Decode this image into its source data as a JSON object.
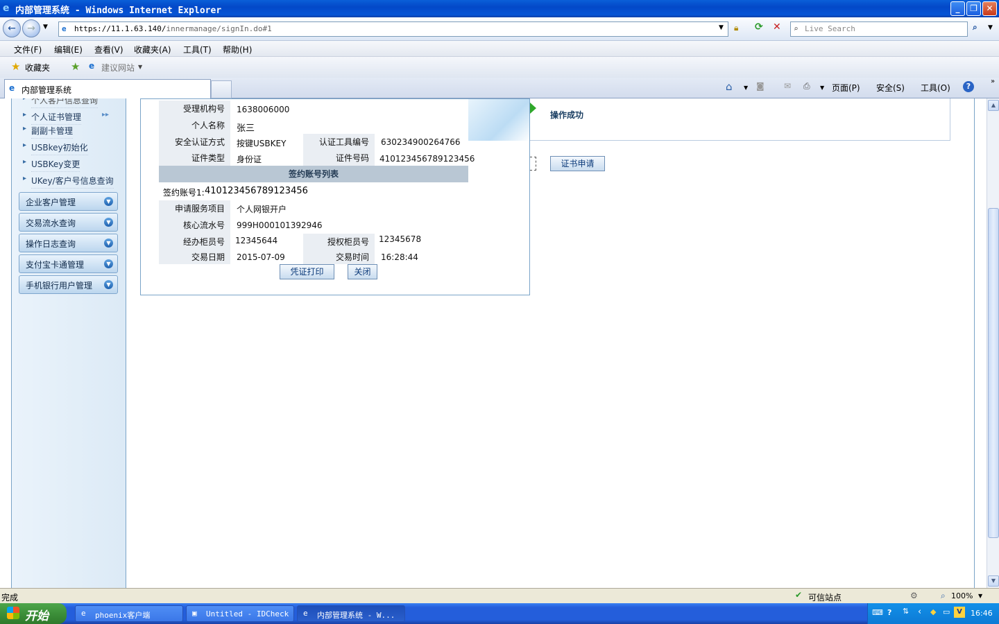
{
  "window": {
    "title": "内部管理系统 - Windows Internet Explorer"
  },
  "address": {
    "url_host": "https://11.1.63.140/",
    "url_path": "innermanage/signIn.do#1",
    "search_placeholder": "Live Search"
  },
  "menu": [
    "文件(F)",
    "编辑(E)",
    "查看(V)",
    "收藏夹(A)",
    "工具(T)",
    "帮助(H)"
  ],
  "favorites": {
    "label": "收藏夹",
    "suggest": "建议网站"
  },
  "tab": {
    "label": "内部管理系统"
  },
  "commands": {
    "page": "页面(P)",
    "safety": "安全(S)",
    "tools": "工具(O)"
  },
  "sidebar": {
    "cut_item": "个人客户信息查询",
    "links": [
      "个人证书管理",
      "副副卡管理",
      "USBkey初始化",
      "USBKey变更",
      "UKey/客户号信息查询"
    ],
    "sections": [
      "企业客户管理",
      "交易流水查询",
      "操作日志查询",
      "支付宝卡通管理",
      "手机银行用户管理"
    ]
  },
  "result": {
    "status": "操作成功",
    "apply_button": "证书申请"
  },
  "dialog": {
    "rows": [
      {
        "label": "受理机构号",
        "value": "1638006000"
      },
      {
        "label": "个人名称",
        "value": "张三"
      }
    ],
    "auth_label": "安全认证方式",
    "auth_value": "按键USBKEY",
    "tool_label": "认证工具编号",
    "tool_value": "630234900264766",
    "idtype_label": "证件类型",
    "idtype_value": "身份证",
    "idno_label": "证件号码",
    "idno_value": "410123456789123456",
    "section_title": "签约账号列表",
    "account_label": "签约账号1:",
    "account_value": "410123456789123456",
    "service_label": "申请服务项目",
    "service_value": "个人网银开户",
    "core_label": "核心流水号",
    "core_value": "999H000101392946",
    "teller_label": "经办柜员号",
    "teller_value": "12345644",
    "auth_teller_label": "授权柜员号",
    "auth_teller_value": "12345678",
    "date_label": "交易日期",
    "date_value": "2015-07-09",
    "time_label": "交易时间",
    "time_value": "16:28:44",
    "print_button": "凭证打印",
    "close_button": "关闭"
  },
  "status": {
    "left": "完成",
    "zone": "可信站点",
    "zoom": "100%"
  },
  "taskbar": {
    "start": "开始",
    "tasks": [
      "phoenix客户端",
      "Untitled - IDCheck",
      "内部管理系统 - W..."
    ],
    "clock": "16:46"
  },
  "colors": {
    "accent": "#245edb",
    "success": "#2fa82a"
  }
}
